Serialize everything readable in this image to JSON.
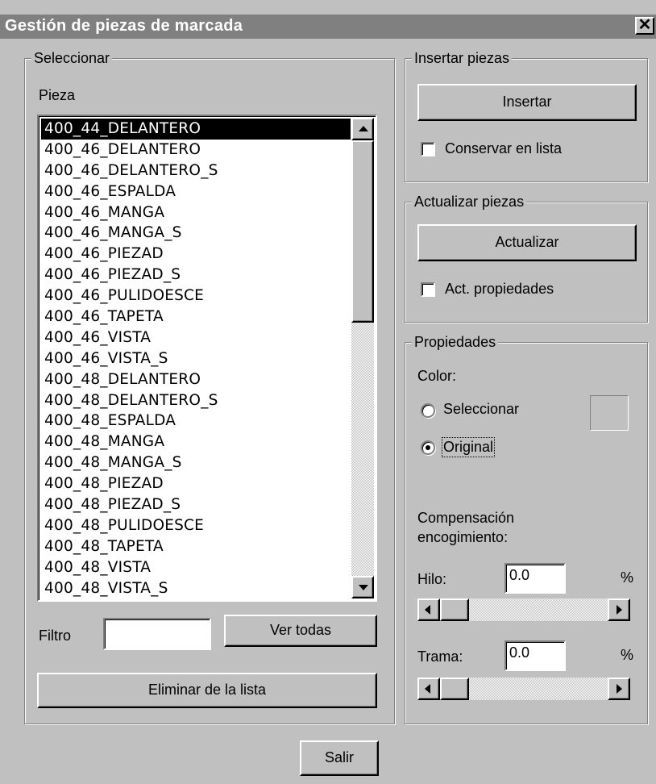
{
  "window": {
    "title": "Gestión de piezas de marcada",
    "close_label": "✕"
  },
  "select_group": {
    "legend": "Seleccionar",
    "pieza_label": "Pieza",
    "items": [
      "400_44_DELANTERO",
      "400_46_DELANTERO",
      "400_46_DELANTERO_S",
      "400_46_ESPALDA",
      "400_46_MANGA",
      "400_46_MANGA_S",
      "400_46_PIEZAD",
      "400_46_PIEZAD_S",
      "400_46_PULIDOESCE",
      "400_46_TAPETA",
      "400_46_VISTA",
      "400_46_VISTA_S",
      "400_48_DELANTERO",
      "400_48_DELANTERO_S",
      "400_48_ESPALDA",
      "400_48_MANGA",
      "400_48_MANGA_S",
      "400_48_PIEZAD",
      "400_48_PIEZAD_S",
      "400_48_PULIDOESCE",
      "400_48_TAPETA",
      "400_48_VISTA",
      "400_48_VISTA_S"
    ],
    "selected_index": 0,
    "filter_label": "Filtro",
    "filter_value": "",
    "ver_todas_label": "Ver todas",
    "eliminar_label": "Eliminar de la lista"
  },
  "insert_group": {
    "legend": "Insertar piezas",
    "button_label": "Insertar",
    "checkbox_label": "Conservar en lista",
    "checked": false
  },
  "update_group": {
    "legend": "Actualizar piezas",
    "button_label": "Actualizar",
    "checkbox_label": "Act. propiedades",
    "checked": false
  },
  "props_group": {
    "legend": "Propiedades",
    "color_label": "Color:",
    "radio_select_label": "Seleccionar",
    "radio_original_label": "Original",
    "selected_radio": "Original",
    "swatch_color": "#c0c0c0",
    "comp_label_1": "Compensación",
    "comp_label_2": "encogimiento:",
    "hilo_label": "Hilo:",
    "hilo_value": "0.0",
    "trama_label": "Trama:",
    "trama_value": "0.0",
    "percent": "%"
  },
  "footer": {
    "salir_label": "Salir"
  }
}
